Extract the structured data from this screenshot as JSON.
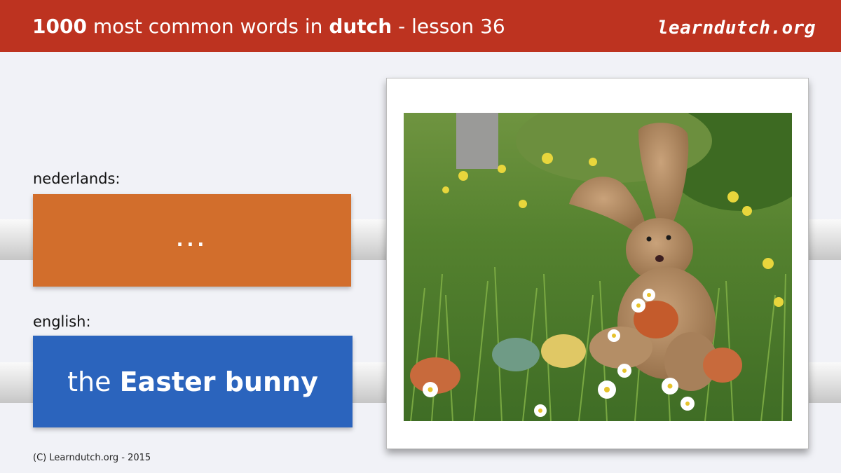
{
  "header": {
    "title_count": "1000",
    "title_middle": " most common words in ",
    "title_language": "dutch",
    "title_suffix": " - lesson 36",
    "brand": "learndutch.org"
  },
  "cards": {
    "dutch_label": "nederlands:",
    "dutch_value": "...",
    "english_label": "english:",
    "english_article": "the ",
    "english_word": "Easter bunny"
  },
  "footer": {
    "copyright": "(C) Learndutch.org - 2015"
  },
  "colors": {
    "header_bg": "#bd3320",
    "dutch_card": "#d26e2c",
    "english_card": "#2b64bd",
    "page_bg": "#f1f2f7"
  }
}
